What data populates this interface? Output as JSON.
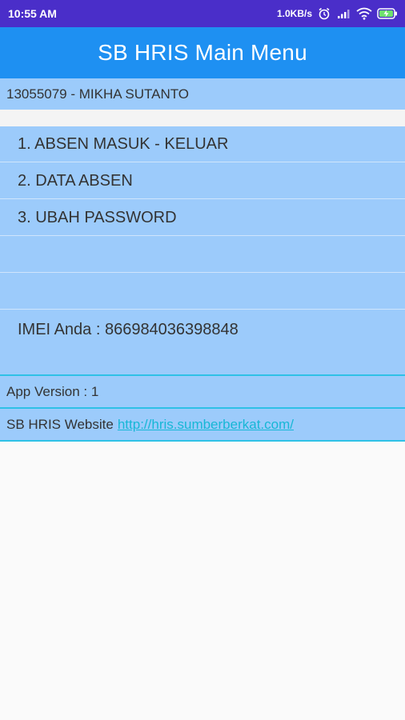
{
  "status_bar": {
    "time": "10:55 AM",
    "speed": "1.0KB/s",
    "icons": [
      "alarm-icon",
      "signal-icon",
      "wifi-icon",
      "battery-charging-icon"
    ]
  },
  "app_bar": {
    "title": "SB HRIS Main Menu"
  },
  "user": {
    "label": "13055079 - MIKHA SUTANTO"
  },
  "menu": {
    "items": [
      {
        "label": "1. ABSEN MASUK - KELUAR"
      },
      {
        "label": "2. DATA ABSEN"
      },
      {
        "label": "3. UBAH PASSWORD"
      },
      {
        "label": ""
      },
      {
        "label": ""
      }
    ]
  },
  "imei": {
    "label": "IMEI Anda : 866984036398848"
  },
  "footer": {
    "version": "App Version : 1",
    "website_label": "SB HRIS Website",
    "website_url": "http://hris.sumberberkat.com/"
  },
  "colors": {
    "status_bar": "#4a2ec9",
    "app_bar": "#1e90f2",
    "panel": "#9ccbfb",
    "divider": "#2ec1e6",
    "link": "#17b7d6"
  }
}
